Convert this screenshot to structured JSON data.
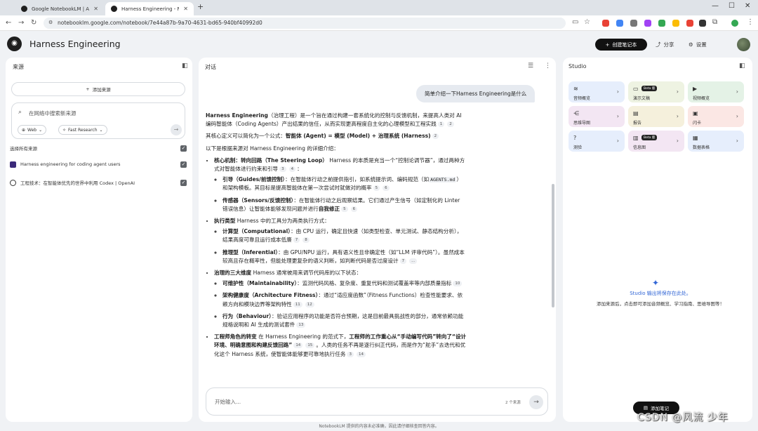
{
  "browser": {
    "tabs": [
      {
        "title": "Google NotebookLM | AI 研..."
      },
      {
        "title": "Harness Engineering - Note..."
      }
    ],
    "new_tab": "+",
    "url": "notebooklm.google.com/notebook/7e44a87b-9a70-4631-bd65-940bf40992d0"
  },
  "header": {
    "app_name": "Harness Engineering",
    "create_label": "创建笔记本",
    "share_label": "分享",
    "settings_label": "设置"
  },
  "sources": {
    "title": "来源",
    "add_label": "添加来源",
    "search_placeholder": "在网络中搜索新来源",
    "web_chip": "Web",
    "research_chip": "Fast Research",
    "select_all": "选择所有来源",
    "items": [
      {
        "title": "Harness engineering for coding agent users"
      },
      {
        "title": "工程技术：在智能体优先的世界中利用 Codex | OpenAI"
      }
    ]
  },
  "chat": {
    "title": "对话",
    "user_query": "简单介绍一下Harness Engineering是什么",
    "composer_placeholder": "开始输入...",
    "source_count": "2 个来源",
    "answer": {
      "intro_term": "Harness Engineering",
      "intro_text": "（治理工程）是一个旨在通过构建一套系统化的控制与反馈机制，来提高人类对 AI 编码智能体（Coding Agents）产出结果的信任，从而实现更高程度自主化的心理模型和工程实践",
      "formula_prefix": "其核心定义可以简化为一个公式：",
      "formula_bold": "智能体 (Agent) = 模型 (Model) + 治理系统 (Harness)",
      "detail_intro": "以下是根据来源对 Harness Engineering 的详细介绍：",
      "b1_title": "核心机制：转向回路（The Steering Loop）",
      "b1_text": "Harness 的本质是充当一个“控制论调节器”，通过两种方式对智能体进行约束和引导",
      "b1a_title": "引导（Guides/前馈控制）",
      "b1a_text1": "：在智能体行动之前提供指引，如系统提示词、编码规范（如",
      "b1a_code": "AGENTS.md",
      "b1a_text2": "）和架构模板。其目标是提高智能体在第一次尝试时就做对的概率",
      "b1b_title": "传感器（Sensors/反馈控制）",
      "b1b_text1": "：在智能体行动之后观察结果。它们通过产生信号（如定制化的 Linter 错误信息）让智能体能够发现问题并进行",
      "b1b_bold": "自我修正",
      "b2_title": "执行类型",
      "b2_text": "Harness 中的工具分为两类执行方式：",
      "b2a_title": "计算型（Computational）",
      "b2a_text": "：由 CPU 运行，确定且快速（如类型检查、单元测试、静态结构分析），结果高度可靠且运行成本低廉",
      "b2b_title": "推理型（Inferential）",
      "b2b_text": "：由 GPU/NPU 运行，具有语义性且非确定性（如“LLM 评审代码”）。虽然成本较高且存在概率性，但能处理更复杂的语义判断，如判断代码是否过度设计",
      "b3_title": "治理的三大维度",
      "b3_text": "Harness 通常被用来调节代码库的以下状态：",
      "b3a_title": "可维护性（Maintainability）",
      "b3a_text": "：监测代码风格、复杂度、重复代码和测试覆盖率等内部质量指标",
      "b3b_title": "架构健康度（Architecture Fitness）",
      "b3b_text": "：通过“适应度函数”（Fitness Functions）检查性能要求、依赖方向和模块边界等架构特性",
      "b3c_title": "行为（Behaviour）",
      "b3c_text": "：验证应用程序的功能是否符合预期，这是目前最具挑战性的部分，通常依赖功能规格说明和 AI 生成的测试套件",
      "b4_title": "工程师角色的转变",
      "b4_text1": "在 Harness Engineering 的范式下，",
      "b4_bold": "工程师的工作重心从“手动编写代码”转向了“设计环境、明确意图和构建反馈回路”",
      "b4_text2": "。人类的任务不再是逐行纠正代码，而是作为“舵手”去迭代和优化这个 Harness 系统，使智能体能够更可靠地执行任务"
    },
    "citations": {
      "c1": "1",
      "c2": "2",
      "c3": "2",
      "c4": "3",
      "c5": "4",
      "c6": "5",
      "c7": "6",
      "c8": "5",
      "c9": "6",
      "c10": "7",
      "c11": "8",
      "c12": "7",
      "c13": "...",
      "c14": "10",
      "c15": "11",
      "c16": "12",
      "c17": "13",
      "c18": "14",
      "c19": "15",
      "c20": "3",
      "c21": "14"
    }
  },
  "studio": {
    "title": "Studio",
    "tiles": [
      {
        "label": "音频概览",
        "beta": ""
      },
      {
        "label": "演示文稿",
        "beta": "Beta 版"
      },
      {
        "label": "视频概览",
        "beta": ""
      },
      {
        "label": "思维导图",
        "beta": ""
      },
      {
        "label": "报告",
        "beta": ""
      },
      {
        "label": "闪卡",
        "beta": ""
      },
      {
        "label": "测验",
        "beta": ""
      },
      {
        "label": "信息图",
        "beta": "Beta 版"
      },
      {
        "label": "数据表格",
        "beta": ""
      }
    ],
    "tile_colors": [
      "#e6eefc",
      "#eef3e2",
      "#e4f2e6",
      "#f3e6f3",
      "#f5f0dc",
      "#fbe7e4",
      "#e6eefc",
      "#f3e6f3",
      "#e6eefc"
    ],
    "empty_title": "Studio 输出将保存在此处。",
    "empty_desc": "添加来源后，点击即可添加音频概览、学习指南、思维导图等！",
    "add_note_label": "添加笔记"
  },
  "footer": {
    "disclaimer": "NotebookLM 提供的内容未必准确，因此请仔细核查回答内容。"
  },
  "watermark": "CSDN @风流 少年"
}
